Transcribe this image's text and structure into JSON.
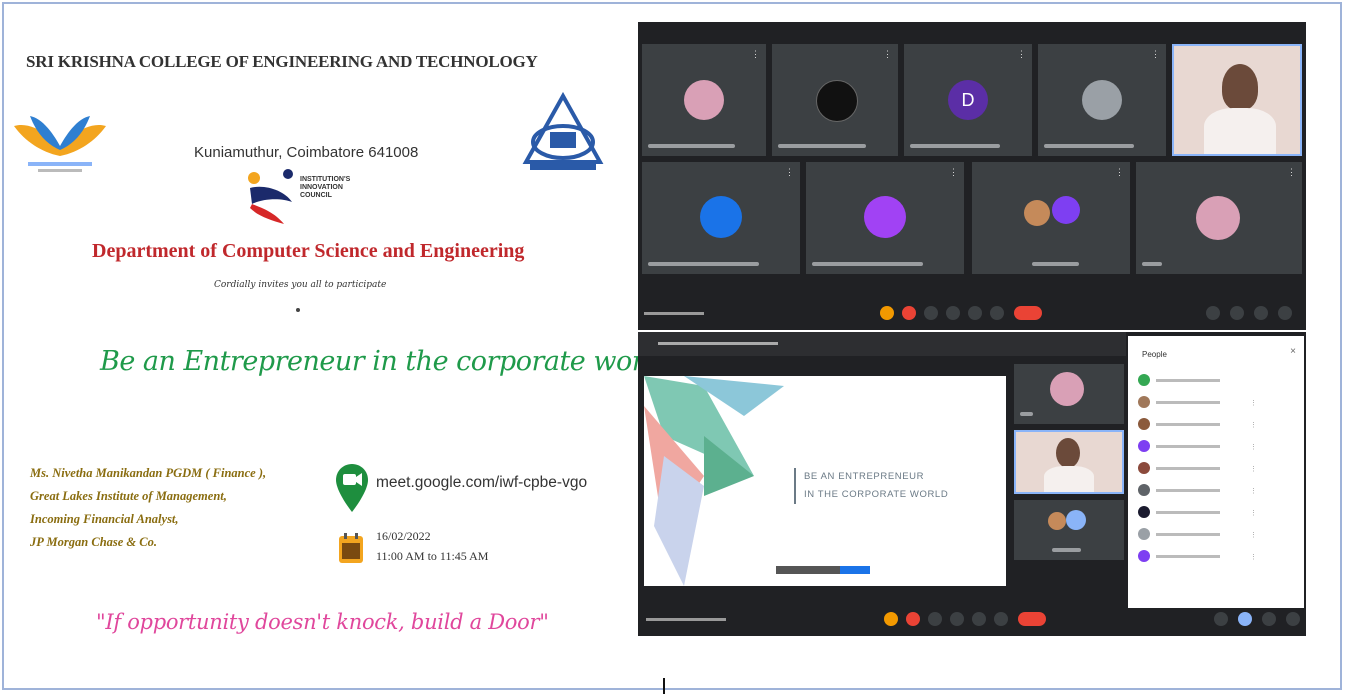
{
  "poster": {
    "college_name": "SRI KRISHNA COLLEGE OF ENGINEERING AND TECHNOLOGY",
    "address": "Kuniamuthur, Coimbatore 641008",
    "iic_label": [
      "INSTITUTION'S",
      "INNOVATION",
      "COUNCIL"
    ],
    "department": "Department of Computer Science and Engineering",
    "invitation": "Cordially invites you all to participate",
    "event_title": "Be an Entrepreneur in the corporate world",
    "speaker": {
      "line1": "Ms. Nivetha Manikandan  PGDM ( Finance ),",
      "line2": "Great Lakes Institute of Management,",
      "line3": "Incoming Financial Analyst,",
      "line4": "JP Morgan Chase & Co."
    },
    "meet_link": "meet.google.com/iwf-cpbe-vgo",
    "date": "16/02/2022",
    "time": "11:00 AM to 11:45 AM",
    "quote": "\"If opportunity doesn't knock, build a Door\""
  },
  "meet_session_1": {
    "tiles_row1": [
      "avatar-photo",
      "avatar-logo",
      "avatar-letter-d",
      "avatar-default",
      "video-speaker"
    ],
    "tiles_row2": [
      "avatar-default-blue",
      "avatar-purple",
      "avatar-group",
      "avatar-photo"
    ],
    "avatar_letter": "D",
    "colors": {
      "background": "#202124",
      "tile": "#3c4043",
      "end_call": "#ea4335",
      "accent": "#8ab4f8"
    }
  },
  "meet_session_2": {
    "slide_text_line1": "BE AN ENTREPRENEUR",
    "slide_text_line2": "IN THE CORPORATE WORLD",
    "people_panel_title": "People",
    "participant_count": 9
  }
}
